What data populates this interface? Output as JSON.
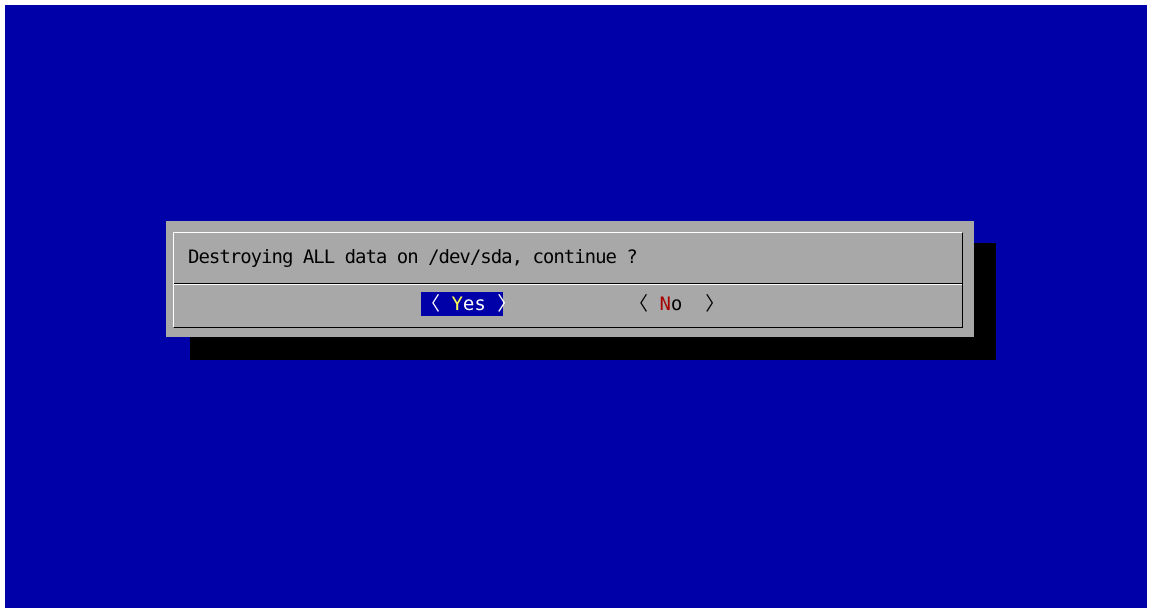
{
  "screen": {
    "background_color": "#0000a8"
  },
  "dialog": {
    "message": "Destroying ALL data on /dev/sda, continue ?",
    "background_color": "#a8a8a8",
    "yes_button": {
      "left_bracket": "〈 ",
      "hotkey": "Y",
      "rest": "es",
      "right_bracket": " 〉",
      "selected": true,
      "highlight_color": "#0000a8"
    },
    "no_button": {
      "left_bracket": "〈 ",
      "hotkey": "N",
      "rest": "o",
      "right_bracket": "  〉",
      "selected": false,
      "hotkey_color": "#a80000"
    }
  }
}
